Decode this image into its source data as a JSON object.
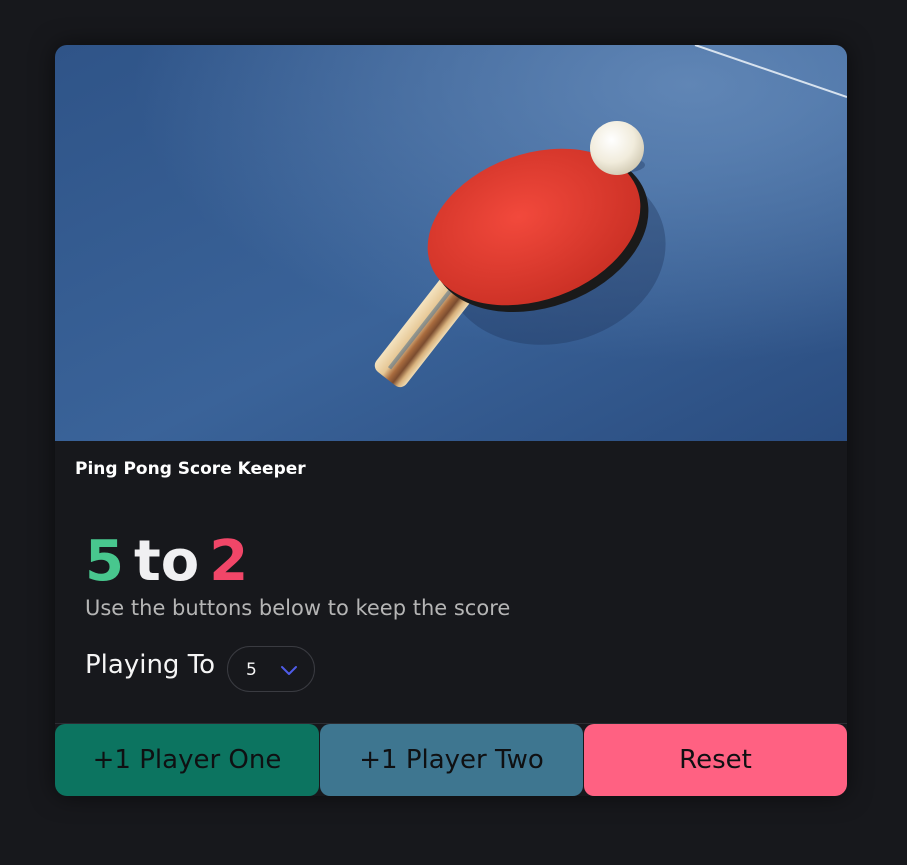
{
  "card": {
    "title": "Ping Pong Score Keeper",
    "image": "ping-pong-paddle-photo"
  },
  "score": {
    "player_one": "5",
    "separator": "to",
    "player_two": "2"
  },
  "subtitle": "Use the buttons below to keep the score",
  "playing_to": {
    "label": "Playing To",
    "selected": "5"
  },
  "buttons": {
    "player_one": "+1 Player One",
    "player_two": "+1 Player Two",
    "reset": "Reset"
  },
  "colors": {
    "player_one_score": "#48c78e",
    "player_two_score": "#f14668",
    "button_player_one": "#0c7460",
    "button_player_two": "#3e7690",
    "button_reset": "#ff6182",
    "background": "#17181c"
  },
  "icons": {
    "select_arrow": "chevron-down-icon"
  }
}
